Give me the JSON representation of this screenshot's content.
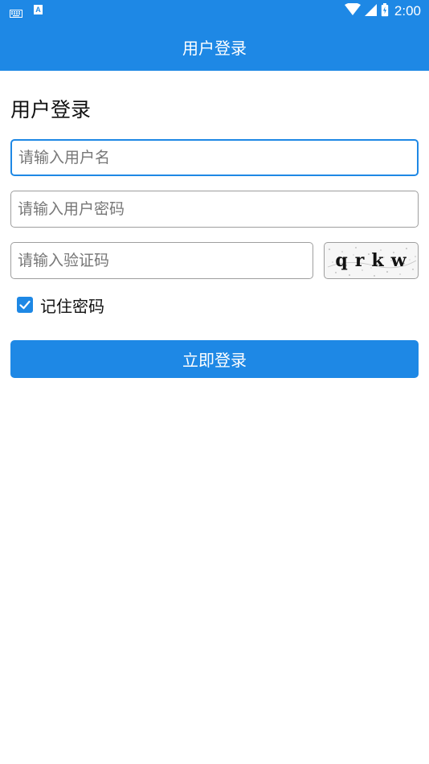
{
  "status_bar": {
    "time": "2:00",
    "notification_icons": [
      "keyboard-icon",
      "a-icon"
    ],
    "system_icons": [
      "wifi-icon",
      "cellular-signal-icon",
      "battery-icon"
    ],
    "a_icon_letter": "A"
  },
  "app_bar": {
    "title": "用户登录"
  },
  "form": {
    "heading": "用户登录",
    "username": {
      "value": "",
      "placeholder": "请输入用户名"
    },
    "password": {
      "value": "",
      "placeholder": "请输入用户密码"
    },
    "captcha_input": {
      "value": "",
      "placeholder": "请输入验证码"
    },
    "captcha_image_text": "qrkw",
    "remember": {
      "label": "记住密码",
      "checked": true
    },
    "submit_label": "立即登录"
  },
  "colors": {
    "primary": "#1e88e5",
    "background": "#ffffff",
    "input_border": "#9e9e9e",
    "text": "#111111"
  }
}
